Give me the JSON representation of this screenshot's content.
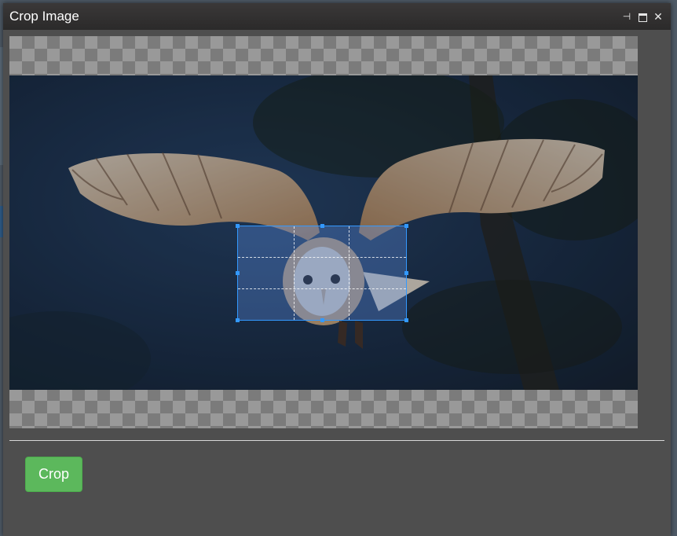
{
  "window": {
    "title": "Crop Image",
    "controls": [
      "pin-icon",
      "maximize-icon",
      "close-icon"
    ],
    "close_glyph": "✕",
    "pin_glyph": "⊣"
  },
  "crop_tool": {
    "image_alt": "Barn owl in flight",
    "selection_fill": "#66a0ff",
    "selection_border": "#3399ff"
  },
  "footer": {
    "crop_label": "Crop",
    "crop_color": "#5cb85c"
  }
}
